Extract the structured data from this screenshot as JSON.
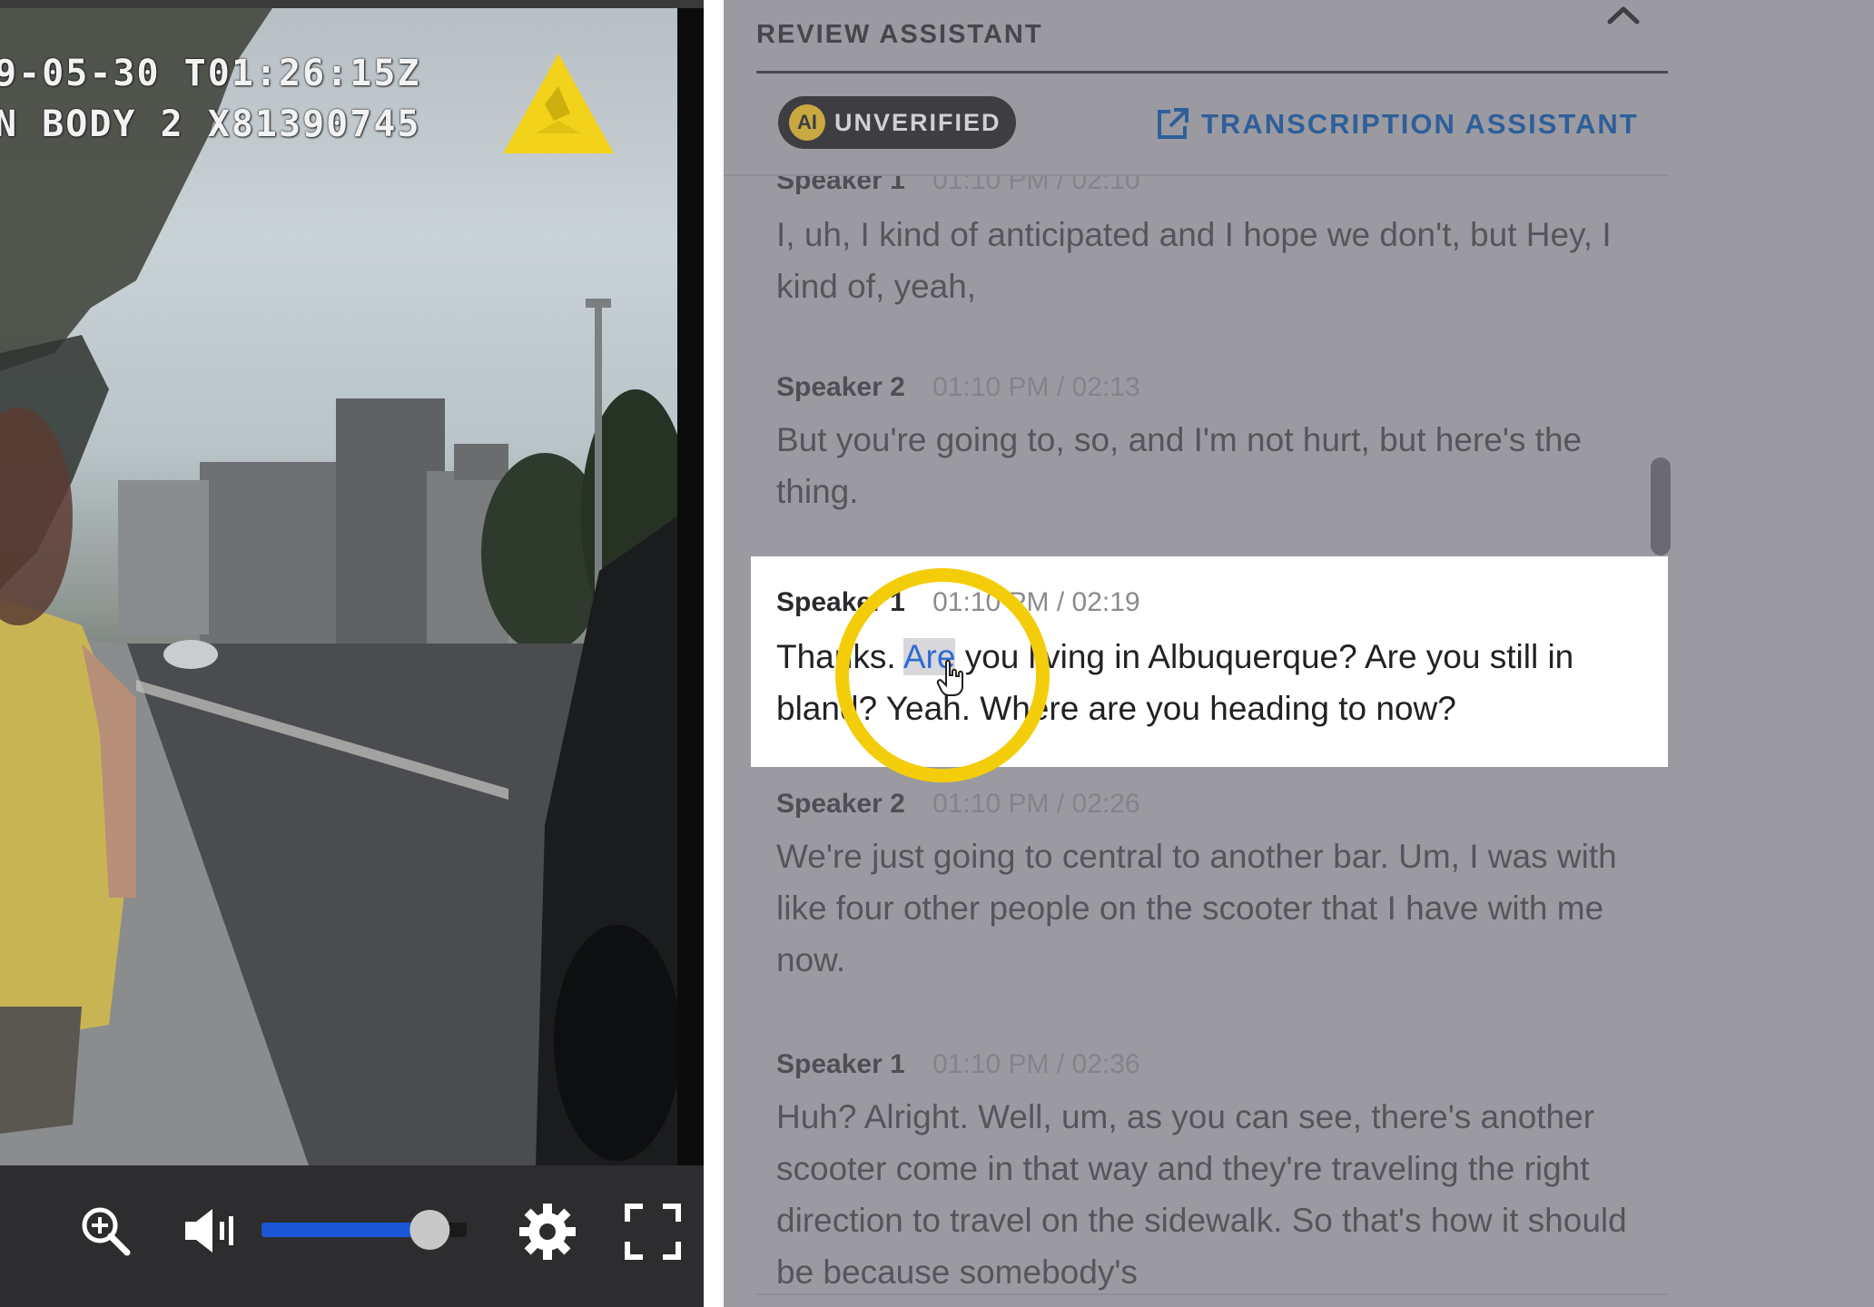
{
  "video": {
    "osd_line1": "9-05-30 T01:26:15Z",
    "osd_line2": "N BODY 2 X81390745",
    "logo_icon": "axon-triangle-icon",
    "controls": {
      "zoom_icon": "zoom-in-icon",
      "volume_icon": "volume-icon",
      "volume_level": 0.82,
      "settings_icon": "gear-icon",
      "fullscreen_icon": "fullscreen-icon"
    }
  },
  "review": {
    "title": "REVIEW ASSISTANT",
    "badge_ai": "AI",
    "badge_label": "UNVERIFIED",
    "transcription_button": "TRANSCRIPTION ASSISTANT",
    "entries": [
      {
        "speaker": "Speaker 1",
        "time": "01:10 PM / 02:10",
        "text": "I, uh, I kind of anticipated and I hope we don't, but Hey, I kind of, yeah,"
      },
      {
        "speaker": "Speaker 2",
        "time": "01:10 PM / 02:13",
        "text": "But you're going to, so, and I'm not hurt, but here's the thing."
      },
      {
        "speaker": "Speaker 1",
        "time": "01:10 PM / 02:19",
        "text_before": "Thanks. ",
        "text_highlight": "Are",
        "text_after": " you living in Albuquerque? Are you still in bland? Yeah. Where are you heading to now?"
      },
      {
        "speaker": "Speaker 2",
        "time": "01:10 PM / 02:26",
        "text": "We're just going to central to another bar. Um, I was with like four other people on the scooter that I have with me now."
      },
      {
        "speaker": "Speaker 1",
        "time": "01:10 PM / 02:36",
        "text": "Huh? Alright. Well, um, as you can see, there's another scooter come in that way and they're traveling the right direction to travel on the sidewalk. So that's how it should be because somebody's"
      }
    ]
  },
  "colors": {
    "highlight_ring": "#f3cd0a",
    "link_blue": "#2f6bd3",
    "active_row": "#ffffff"
  }
}
